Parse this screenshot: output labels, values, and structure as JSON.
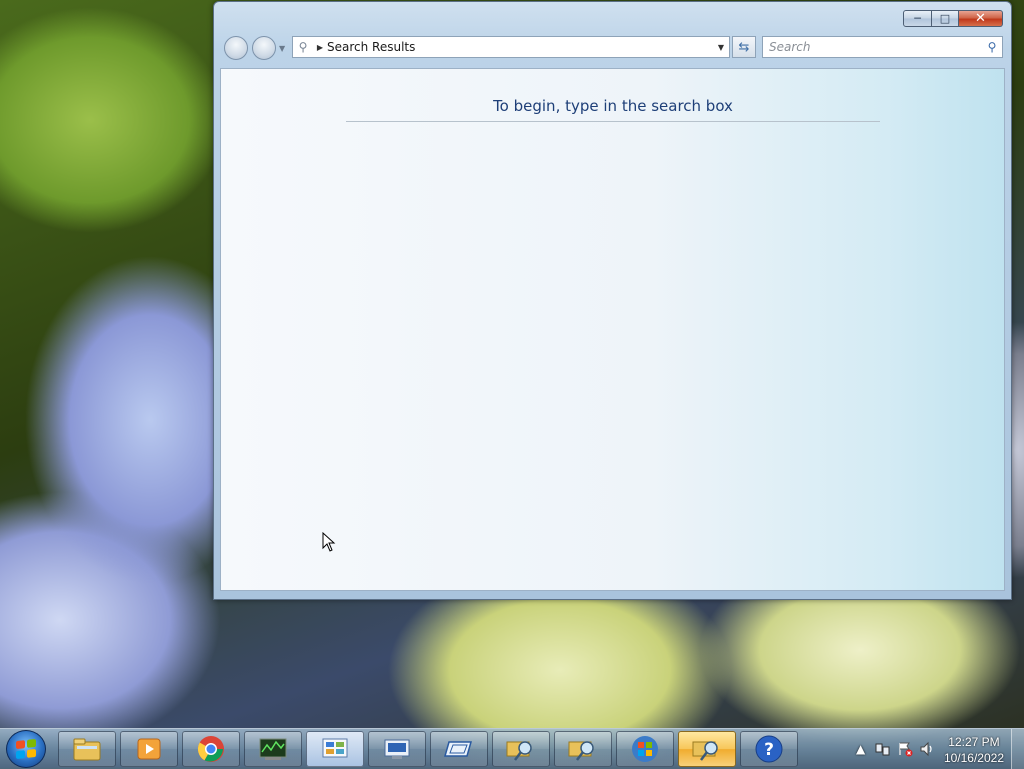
{
  "window": {
    "caption_buttons": {
      "minimize": "minimize-icon",
      "maximize": "maximize-icon",
      "close": "close-icon"
    },
    "address_bar": {
      "crumb": "Search Results"
    },
    "search_box": {
      "placeholder": "Search"
    },
    "content": {
      "empty_message": "To begin, type in the search box"
    }
  },
  "taskbar": {
    "start": "windows-start-icon",
    "buttons": [
      {
        "name": "explorer-icon",
        "active": false
      },
      {
        "name": "media-player-icon",
        "active": false
      },
      {
        "name": "chrome-icon",
        "active": false
      },
      {
        "name": "task-manager-icon",
        "active": false
      },
      {
        "name": "control-panel-icon",
        "active": false
      },
      {
        "name": "remote-desktop-icon",
        "active": false
      },
      {
        "name": "tablet-icon",
        "active": false
      },
      {
        "name": "search-folder-icon",
        "active": false
      },
      {
        "name": "search-folder-icon-2",
        "active": false
      },
      {
        "name": "windows-logo-icon",
        "active": false
      },
      {
        "name": "search-folder-icon-3",
        "active": true
      },
      {
        "name": "help-icon",
        "active": false
      }
    ],
    "clock": {
      "time": "12:27 PM",
      "date": "10/16/2022"
    }
  }
}
